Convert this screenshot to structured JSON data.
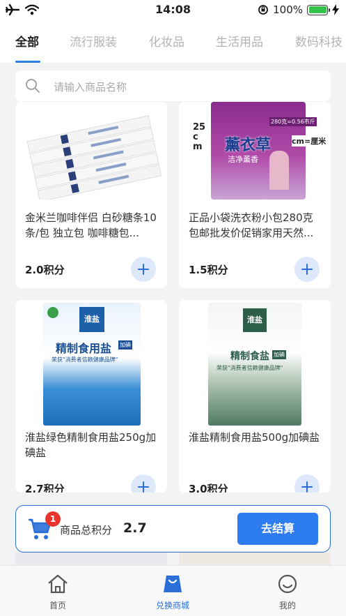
{
  "status_bar": {
    "time": "14:08",
    "battery": "100%"
  },
  "tabs": [
    {
      "label": "全部",
      "active": true
    },
    {
      "label": "流行服装"
    },
    {
      "label": "化妆品"
    },
    {
      "label": "生活用品"
    },
    {
      "label": "数码科技"
    }
  ],
  "search": {
    "placeholder": "请输入商品名称"
  },
  "products": [
    {
      "name": "金米兰咖啡伴侣 白砂糖条10条/包 独立包 咖啡糖包...",
      "points": "2.0积分",
      "image_icon": "sugar-sticks-image"
    },
    {
      "name": "正品小袋洗衣粉小包280克包邮批发价促销家用天然...",
      "points": "1.5积分",
      "image_icon": "detergent-bag-image",
      "image_text": {
        "brand": "薰衣草",
        "sub": "洁净薰香",
        "size": "25cm",
        "note": "cm=厘米",
        "price": "280克=0.56市斤"
      }
    },
    {
      "name": "淮盐绿色精制食用盐250g加碘盐",
      "points": "2.7积分",
      "image_icon": "blue-salt-bag-image",
      "image_text": {
        "brand": "淮盐",
        "title": "精制食用盐",
        "tag": "加碘",
        "slogan": "荣获\"消费者信赖健康品牌\""
      }
    },
    {
      "name": "淮盐精制食用盐500g加碘盐",
      "points": "3.0积分",
      "image_icon": "green-salt-bag-image",
      "image_text": {
        "brand": "淮盐",
        "title": "精制食盐",
        "tag": "加碘",
        "slogan": "荣获\"消费者信赖健康品牌\""
      }
    }
  ],
  "cart": {
    "badge": "1",
    "label": "商品总积分",
    "total": "2.7",
    "checkout_label": "去结算"
  },
  "bottom_nav": [
    {
      "label": "首页",
      "icon": "home-icon"
    },
    {
      "label": "兑换商城",
      "icon": "shop-bag-icon",
      "active": true
    },
    {
      "label": "我的",
      "icon": "profile-smile-icon"
    }
  ],
  "colors": {
    "accent": "#2d7cf0",
    "badge": "#e8352d",
    "add_button_bg": "#dde8fb",
    "background": "#f2f3f5"
  }
}
